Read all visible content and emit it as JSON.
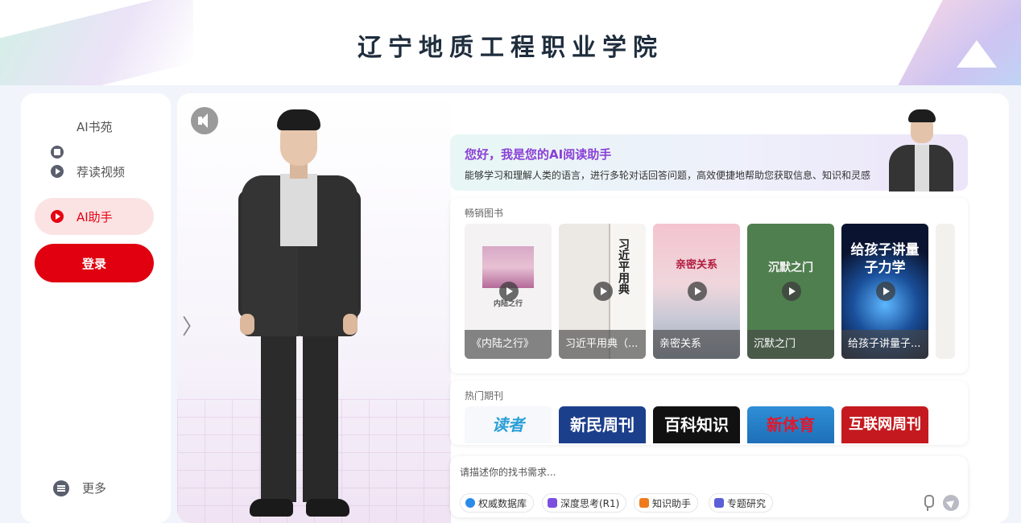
{
  "header": {
    "title": "辽宁地质工程职业学院"
  },
  "sidebar": {
    "items": [
      {
        "label": "AI书苑",
        "icon": "book-icon"
      },
      {
        "label": "荐读视频",
        "icon": "play-circle-icon"
      },
      {
        "label": "AI助手",
        "icon": "chat-icon",
        "active": true
      }
    ],
    "login_label": "登录",
    "more_label": "更多"
  },
  "greeting": {
    "title": "您好，我是您的AI阅读助手",
    "subtitle": "能够学习和理解人类的语言，进行多轮对话回答问题，高效便捷地帮助您获取信息、知识和灵感"
  },
  "stage": {
    "chevron": "〉"
  },
  "books": {
    "section_title": "畅销图书",
    "items": [
      {
        "caption": "《内陆之行》",
        "cover_text": "内陆之行"
      },
      {
        "caption": "习近平用典（...",
        "cover_text": "习近平用典"
      },
      {
        "caption": "亲密关系",
        "cover_text": "亲密关系"
      },
      {
        "caption": "沉默之门",
        "cover_text": "沉默之门"
      },
      {
        "caption": "给孩子讲量子...",
        "cover_text": "给孩子讲量子力学"
      }
    ]
  },
  "journals": {
    "section_title": "热门期刊",
    "items": [
      {
        "title": "读者"
      },
      {
        "title": "新民周刊"
      },
      {
        "title": "百科知识"
      },
      {
        "title": "新体育"
      },
      {
        "title": "互联网周刊"
      }
    ]
  },
  "chat": {
    "placeholder": "请描述你的找书需求...",
    "chips": [
      {
        "label": "权威数据库",
        "color": "#2a8be8"
      },
      {
        "label": "深度思考(R1)",
        "color": "#7b4fe0"
      },
      {
        "label": "知识助手",
        "color": "#f07a1a"
      },
      {
        "label": "专题研究",
        "color": "#5b5fd8"
      }
    ]
  },
  "colors": {
    "accent": "#e60012",
    "greeting_title": "#8a3fd6"
  }
}
